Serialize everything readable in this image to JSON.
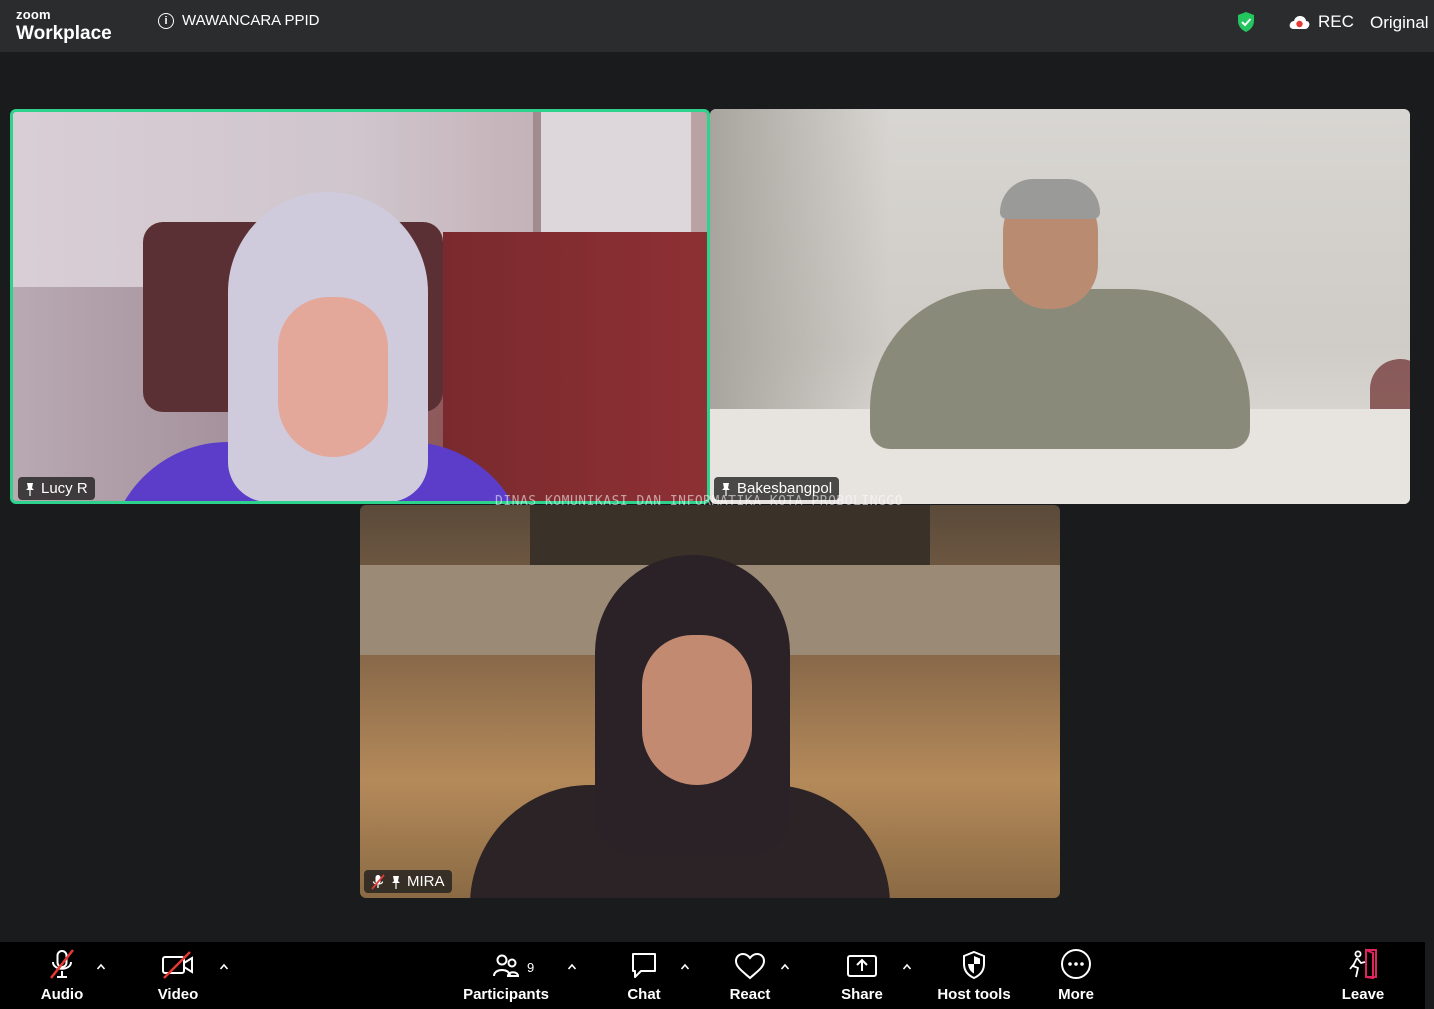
{
  "app": {
    "logo_small": "zoom",
    "logo_big": "Workplace"
  },
  "meeting": {
    "title": "WAWANCARA PPID"
  },
  "status": {
    "rec_label": "REC",
    "view_label": "Original"
  },
  "participants": [
    {
      "name": "Lucy R",
      "active_speaker": true,
      "muted": false
    },
    {
      "name": "Bakesbangpol",
      "active_speaker": false,
      "muted": false
    },
    {
      "name": "MIRA",
      "active_speaker": false,
      "muted": true
    }
  ],
  "watermark": "DINAS KOMUNIKASI DAN INFORMATIKA KOTA PROBOLINGGO",
  "toolbar": {
    "audio": "Audio",
    "video": "Video",
    "participants": "Participants",
    "participants_count": "9",
    "chat": "Chat",
    "react": "React",
    "share": "Share",
    "host_tools": "Host tools",
    "more": "More",
    "leave": "Leave"
  },
  "colors": {
    "active_speaker_border": "#2dd28d",
    "encryption_shield": "#22c55e",
    "rec_dot": "#e53935",
    "leave_accent": "#e0245e"
  }
}
